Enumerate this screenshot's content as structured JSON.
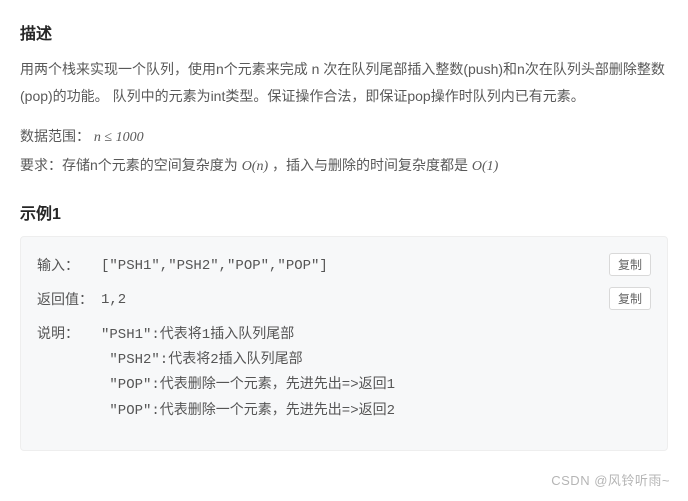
{
  "heading_desc": "描述",
  "desc_text": "用两个栈来实现一个队列，使用n个元素来完成 n 次在队列尾部插入整数(push)和n次在队列头部删除整数(pop)的功能。 队列中的元素为int类型。保证操作合法，即保证pop操作时队列内已有元素。",
  "range_prefix": "数据范围： ",
  "range_math_n": "n",
  "range_math_le": " ≤ 1000",
  "req_prefix": "要求：存储n个元素的空间复杂度为 ",
  "req_space": "O(n)",
  "req_mid": " ，插入与删除的时间复杂度都是 ",
  "req_time": "O(1)",
  "heading_example": "示例1",
  "labels": {
    "input": "输入：",
    "return": "返回值：",
    "explain": "说明："
  },
  "copy_label": "复制",
  "input_value": "[\"PSH1\",\"PSH2\",\"POP\",\"POP\"]",
  "return_value": "1,2",
  "explain_lines": {
    "l1": "\"PSH1\":代表将1插入队列尾部",
    "l2": " \"PSH2\":代表将2插入队列尾部",
    "l3": " \"POP\":代表删除一个元素，先进先出=>返回1",
    "l4": " \"POP\":代表删除一个元素，先进先出=>返回2"
  },
  "watermark": "CSDN @风铃听雨~"
}
